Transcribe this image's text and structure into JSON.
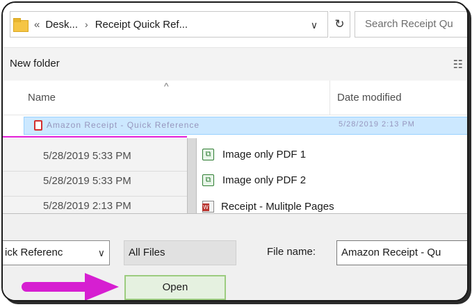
{
  "address_bar": {
    "overflow_glyph": "«",
    "crumb1": "Desk...",
    "separator": "›",
    "crumb2": "Receipt Quick Ref...",
    "dropdown_glyph": "∨"
  },
  "refresh_glyph": "↻",
  "search": {
    "placeholder": "Search Receipt Qu"
  },
  "toolbar": {
    "new_folder": "New folder",
    "view_glyph": "☷"
  },
  "columns": {
    "name": "Name",
    "sort_glyph": "^",
    "date_modified": "Date modified"
  },
  "selected_row": {
    "name": "Amazon Receipt - Quick Reference",
    "date": "5/28/2019 2:13 PM"
  },
  "list_dates": [
    "5/28/2019 5:33 PM",
    "5/28/2019 5:33 PM",
    "5/28/2019 2:13 PM"
  ],
  "files": [
    {
      "name": "Image only PDF 1",
      "icon": "pdf-image-icon"
    },
    {
      "name": "Image only PDF 2",
      "icon": "pdf-image-icon"
    },
    {
      "name": "Receipt - Mulitple Pages",
      "icon": "word-doc-icon"
    }
  ],
  "bottom": {
    "file_type": "ick Referenc",
    "file_type_chevron": "∨",
    "filter": "All Files",
    "file_name_label": "File name:",
    "file_name_value": "Amazon Receipt - Qu",
    "open_button": "Open"
  },
  "colors": {
    "highlight": "#cce8ff",
    "arrow": "#d61fd1",
    "open_border": "#9ccc7f"
  }
}
